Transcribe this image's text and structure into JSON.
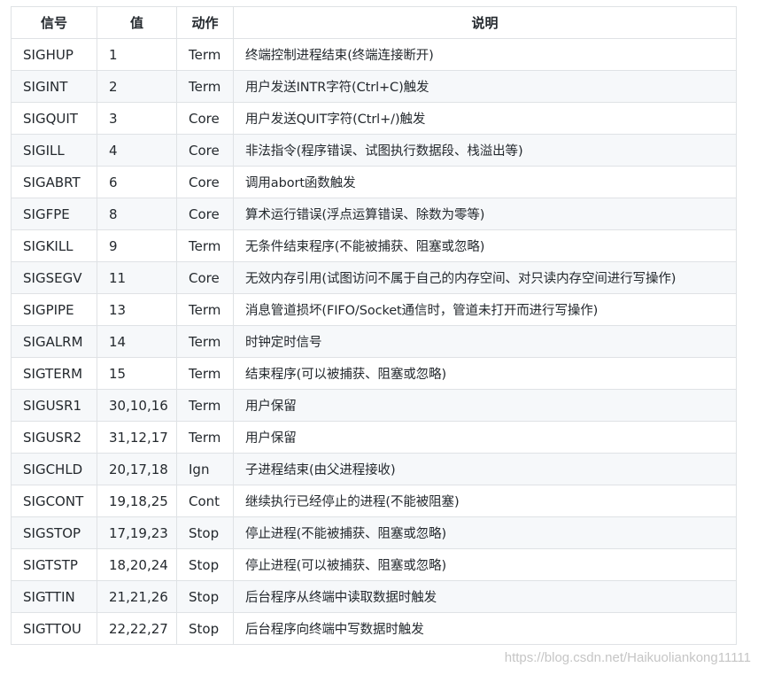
{
  "table": {
    "headers": [
      "信号",
      "值",
      "动作",
      "说明"
    ],
    "rows": [
      [
        "SIGHUP",
        "1",
        "Term",
        "终端控制进程结束(终端连接断开)"
      ],
      [
        "SIGINT",
        "2",
        "Term",
        "用户发送INTR字符(Ctrl+C)触发"
      ],
      [
        "SIGQUIT",
        "3",
        "Core",
        "用户发送QUIT字符(Ctrl+/)触发"
      ],
      [
        "SIGILL",
        "4",
        "Core",
        "非法指令(程序错误、试图执行数据段、栈溢出等)"
      ],
      [
        "SIGABRT",
        "6",
        "Core",
        "调用abort函数触发"
      ],
      [
        "SIGFPE",
        "8",
        "Core",
        "算术运行错误(浮点运算错误、除数为零等)"
      ],
      [
        "SIGKILL",
        "9",
        "Term",
        "无条件结束程序(不能被捕获、阻塞或忽略)"
      ],
      [
        "SIGSEGV",
        "11",
        "Core",
        "无效内存引用(试图访问不属于自己的内存空间、对只读内存空间进行写操作)"
      ],
      [
        "SIGPIPE",
        "13",
        "Term",
        "消息管道损坏(FIFO/Socket通信时，管道未打开而进行写操作)"
      ],
      [
        "SIGALRM",
        "14",
        "Term",
        "时钟定时信号"
      ],
      [
        "SIGTERM",
        "15",
        "Term",
        "结束程序(可以被捕获、阻塞或忽略)"
      ],
      [
        "SIGUSR1",
        "30,10,16",
        "Term",
        "用户保留"
      ],
      [
        "SIGUSR2",
        "31,12,17",
        "Term",
        "用户保留"
      ],
      [
        "SIGCHLD",
        "20,17,18",
        "Ign",
        "子进程结束(由父进程接收)"
      ],
      [
        "SIGCONT",
        "19,18,25",
        "Cont",
        "继续执行已经停止的进程(不能被阻塞)"
      ],
      [
        "SIGSTOP",
        "17,19,23",
        "Stop",
        "停止进程(不能被捕获、阻塞或忽略)"
      ],
      [
        "SIGTSTP",
        "18,20,24",
        "Stop",
        "停止进程(可以被捕获、阻塞或忽略)"
      ],
      [
        "SIGTTIN",
        "21,21,26",
        "Stop",
        "后台程序从终端中读取数据时触发"
      ],
      [
        "SIGTTOU",
        "22,22,27",
        "Stop",
        "后台程序向终端中写数据时触发"
      ]
    ]
  },
  "watermark": "https://blog.csdn.net/Haikuoliankong11111",
  "colors": {
    "border": "#dfe2e5",
    "stripe": "#f6f8fa",
    "text": "#24292e"
  }
}
